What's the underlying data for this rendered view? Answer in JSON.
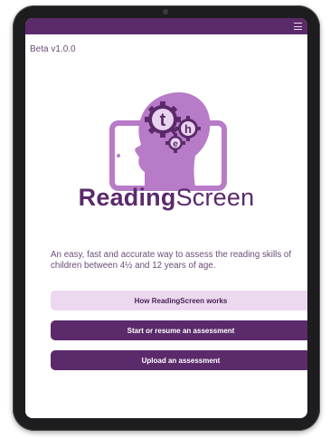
{
  "app": {
    "version": "Beta v1.0.0",
    "brand_bold": "Reading",
    "brand_regular": "Screen",
    "tagline": "An easy, fast and accurate way to assess the reading skills of children between 4½ and 12 years of age."
  },
  "header": {
    "menu_icon": "hamburger-menu-icon"
  },
  "logo": {
    "gear_letters": [
      "t",
      "h",
      "e"
    ]
  },
  "buttons": {
    "how_it_works": "How ReadingScreen works",
    "start_resume": "Start or resume an assessment",
    "upload": "Upload an assessment"
  },
  "colors": {
    "brand_purple": "#5b2a6b",
    "logo_purple": "#b87bc8",
    "light_button": "#ecd9f0"
  }
}
